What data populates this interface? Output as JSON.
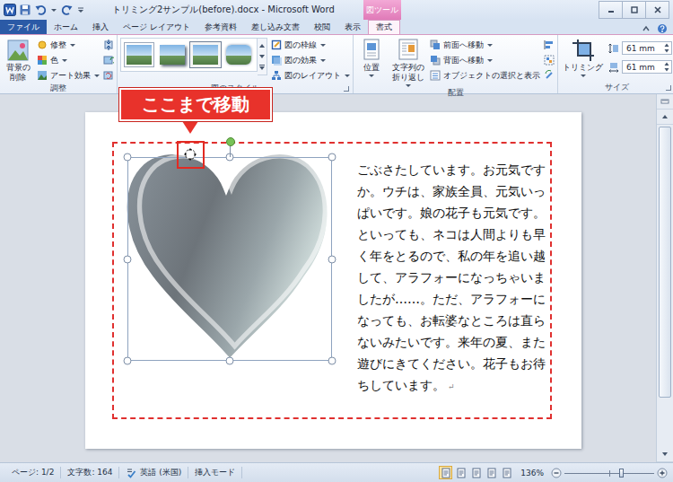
{
  "window": {
    "title": "トリミング2サンプル(before).docx - Microsoft Word",
    "context_tool": "図ツール"
  },
  "tabs": [
    {
      "label": "ファイル",
      "selected": false,
      "kind": "file"
    },
    {
      "label": "ホーム",
      "selected": false,
      "kind": "tab"
    },
    {
      "label": "挿入",
      "selected": false,
      "kind": "tab"
    },
    {
      "label": "ページ レイアウト",
      "selected": false,
      "kind": "tab"
    },
    {
      "label": "参考資料",
      "selected": false,
      "kind": "tab"
    },
    {
      "label": "差し込み文書",
      "selected": false,
      "kind": "tab"
    },
    {
      "label": "校閲",
      "selected": false,
      "kind": "tab"
    },
    {
      "label": "表示",
      "selected": false,
      "kind": "tab"
    },
    {
      "label": "書式",
      "selected": true,
      "kind": "context"
    }
  ],
  "ribbon": {
    "adjust": {
      "label": "調整",
      "remove_background": {
        "lines": [
          "背景の",
          "削除"
        ]
      },
      "commands": [
        {
          "label": "修整",
          "dropdown": true
        },
        {
          "label": "色",
          "dropdown": true
        },
        {
          "label": "アート効果",
          "dropdown": true
        }
      ]
    },
    "styles": {
      "label": "図のスタイル",
      "gallery": [
        {
          "kind": "frame"
        },
        {
          "kind": "shadow"
        },
        {
          "kind": "thick"
        },
        {
          "kind": "soft"
        }
      ],
      "commands": [
        {
          "label": "図の枠線",
          "dropdown": true
        },
        {
          "label": "図の効果",
          "dropdown": true
        },
        {
          "label": "図のレイアウト",
          "dropdown": true
        }
      ]
    },
    "arrange": {
      "label": "配置",
      "position": {
        "lines": [
          "位置"
        ]
      },
      "wrap": {
        "lines": [
          "文字列の",
          "折り返し"
        ]
      },
      "commands": [
        {
          "label": "前面へ移動",
          "dropdown": true
        },
        {
          "label": "背面へ移動",
          "dropdown": true
        },
        {
          "label": "オブジェクトの選択と表示",
          "dropdown": false
        }
      ]
    },
    "size": {
      "label": "サイズ",
      "crop": "トリミング",
      "fields": [
        {
          "kind": "height",
          "value": "61 mm"
        },
        {
          "kind": "width",
          "value": "61 mm"
        }
      ]
    }
  },
  "callout": {
    "text": "ここまで移動"
  },
  "document": {
    "picture": {
      "selected": true
    },
    "lines": [
      "ごぶさたしています。お元気です",
      "か。ウチは、家族全員、元気いっ",
      "ぱいです。娘の花子も元気です。",
      "といっても、ネコは人間よりも早",
      "く年をとるので、私の年を追い越",
      "して、アラフォーになっちゃいま",
      "したが……。ただ、アラフォーに",
      "なっても、お転婆なところは直ら",
      "ないみたいです。来年の夏、また",
      "遊びにきてください。花子もお待",
      "ちしています。"
    ],
    "paragraph_mark": "↵"
  },
  "status_bar": {
    "items": [
      {
        "kind": "text",
        "label": "ページ: 1/2"
      },
      {
        "kind": "text",
        "label": "文字数: 164"
      },
      {
        "kind": "proofing",
        "label": "英語 (米国)"
      },
      {
        "kind": "text",
        "label": "挿入モード"
      }
    ],
    "views": [
      {
        "kind": "print",
        "selected": true
      },
      {
        "kind": "reading",
        "selected": false
      },
      {
        "kind": "web",
        "selected": false
      },
      {
        "kind": "outline",
        "selected": false
      },
      {
        "kind": "draft",
        "selected": false
      }
    ],
    "zoom": "136%",
    "zoom_level": 0.63
  }
}
